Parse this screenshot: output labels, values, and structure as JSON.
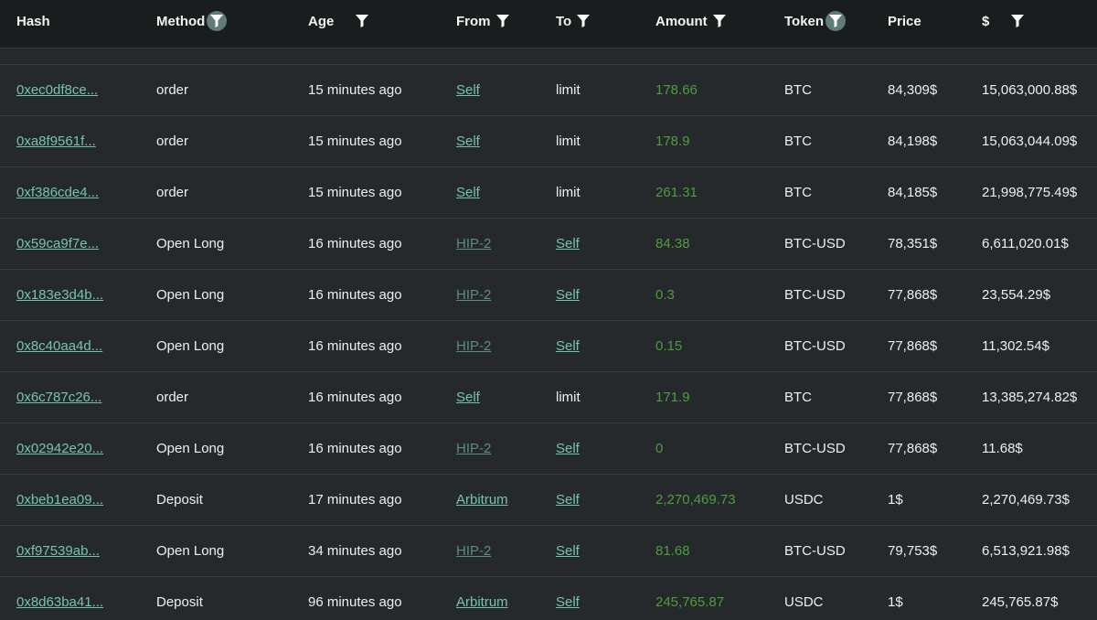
{
  "colors": {
    "header_bg": "#1a1d1e",
    "row_bg": "#26292b",
    "link": "#73c3b3",
    "link_dim": "#5c8b84",
    "amount": "#4a9e3d",
    "filter_active_bg": "#5f7c77"
  },
  "columns": [
    {
      "label": "Hash",
      "filter": null
    },
    {
      "label": "Method",
      "filter": "active"
    },
    {
      "label": "Age",
      "filter": "plain"
    },
    {
      "label": "From",
      "filter": "plain"
    },
    {
      "label": "To",
      "filter": "plain"
    },
    {
      "label": "Amount",
      "filter": "plain"
    },
    {
      "label": "Token",
      "filter": "active"
    },
    {
      "label": "Price",
      "filter": null
    },
    {
      "label": "$",
      "filter": "plain"
    }
  ],
  "rows": [
    {
      "hash": "0xec0df8ce...",
      "method": "order",
      "age": "15 minutes ago",
      "from": "Self",
      "from_style": "link",
      "to": "limit",
      "to_style": "text",
      "amount": "178.66",
      "token": "BTC",
      "price": "84,309$",
      "usd": "15,063,000.88$"
    },
    {
      "hash": "0xa8f9561f...",
      "method": "order",
      "age": "15 minutes ago",
      "from": "Self",
      "from_style": "link",
      "to": "limit",
      "to_style": "text",
      "amount": "178.9",
      "token": "BTC",
      "price": "84,198$",
      "usd": "15,063,044.09$"
    },
    {
      "hash": "0xf386cde4...",
      "method": "order",
      "age": "15 minutes ago",
      "from": "Self",
      "from_style": "link",
      "to": "limit",
      "to_style": "text",
      "amount": "261.31",
      "token": "BTC",
      "price": "84,185$",
      "usd": "21,998,775.49$"
    },
    {
      "hash": "0x59ca9f7e...",
      "method": "Open Long",
      "age": "16 minutes ago",
      "from": "HIP-2",
      "from_style": "dim",
      "to": "Self",
      "to_style": "link",
      "amount": "84.38",
      "token": "BTC-USD",
      "price": "78,351$",
      "usd": "6,611,020.01$"
    },
    {
      "hash": "0x183e3d4b...",
      "method": "Open Long",
      "age": "16 minutes ago",
      "from": "HIP-2",
      "from_style": "dim",
      "to": "Self",
      "to_style": "link",
      "amount": "0.3",
      "token": "BTC-USD",
      "price": "77,868$",
      "usd": "23,554.29$"
    },
    {
      "hash": "0x8c40aa4d...",
      "method": "Open Long",
      "age": "16 minutes ago",
      "from": "HIP-2",
      "from_style": "dim",
      "to": "Self",
      "to_style": "link",
      "amount": "0.15",
      "token": "BTC-USD",
      "price": "77,868$",
      "usd": "11,302.54$"
    },
    {
      "hash": "0x6c787c26...",
      "method": "order",
      "age": "16 minutes ago",
      "from": "Self",
      "from_style": "link",
      "to": "limit",
      "to_style": "text",
      "amount": "171.9",
      "token": "BTC",
      "price": "77,868$",
      "usd": "13,385,274.82$"
    },
    {
      "hash": "0x02942e20...",
      "method": "Open Long",
      "age": "16 minutes ago",
      "from": "HIP-2",
      "from_style": "dim",
      "to": "Self",
      "to_style": "link",
      "amount": "0",
      "token": "BTC-USD",
      "price": "77,868$",
      "usd": "11.68$"
    },
    {
      "hash": "0xbeb1ea09...",
      "method": "Deposit",
      "age": "17 minutes ago",
      "from": "Arbitrum",
      "from_style": "link",
      "to": "Self",
      "to_style": "link",
      "amount": "2,270,469.73",
      "token": "USDC",
      "price": "1$",
      "usd": "2,270,469.73$"
    },
    {
      "hash": "0xf97539ab...",
      "method": "Open Long",
      "age": "34 minutes ago",
      "from": "HIP-2",
      "from_style": "dim",
      "to": "Self",
      "to_style": "link",
      "amount": "81.68",
      "token": "BTC-USD",
      "price": "79,753$",
      "usd": "6,513,921.98$"
    },
    {
      "hash": "0x8d63ba41...",
      "method": "Deposit",
      "age": "96 minutes ago",
      "from": "Arbitrum",
      "from_style": "link",
      "to": "Self",
      "to_style": "link",
      "amount": "245,765.87",
      "token": "USDC",
      "price": "1$",
      "usd": "245,765.87$"
    }
  ]
}
